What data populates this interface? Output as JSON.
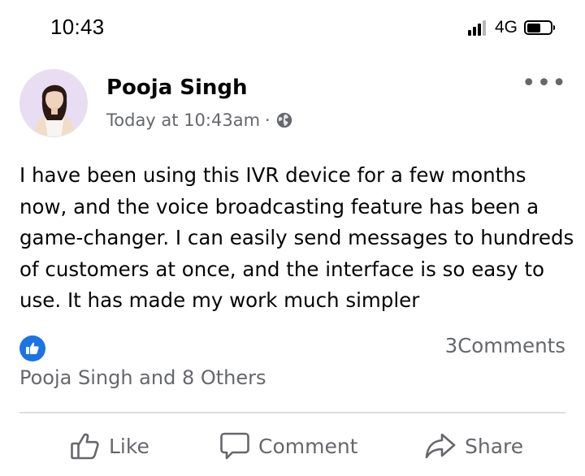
{
  "status_bar": {
    "time": "10:43",
    "network": "4G"
  },
  "post": {
    "author": "Pooja Singh",
    "timestamp": "Today at 10:43am",
    "separator": "·",
    "privacy_icon": "globe-icon",
    "more_icon": "more-options-icon",
    "more_label": "•••",
    "text": "I have been using this IVR device for a few months now, and the voice broadcasting feature has been a game-changer. I can easily send messages to hundreds of customers at once, and the interface is so easy to use. It has made my work much simpler"
  },
  "reactions": {
    "icon": "like-reaction-icon",
    "comments_count": "3Comments",
    "reactors_text": "Pooja Singh and 8 Others"
  },
  "actions": {
    "like_label": "Like",
    "comment_label": "Comment",
    "share_label": "Share"
  },
  "colors": {
    "accent": "#1b74e4",
    "secondary_text": "#65676b",
    "primary_text": "#050505",
    "divider": "#dadde1"
  }
}
